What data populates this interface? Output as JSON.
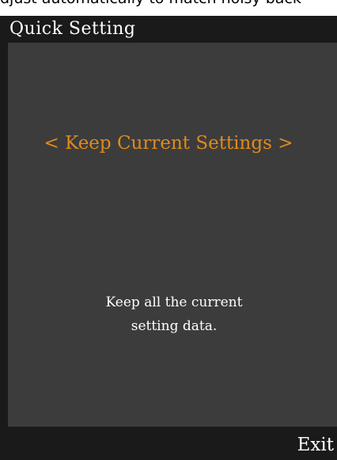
{
  "top_caption": "djust automatically to match noisy back",
  "header": {
    "title": "Quick Setting"
  },
  "option": {
    "prev_arrow": "<",
    "label": "Keep Current Settings",
    "next_arrow": ">"
  },
  "description": {
    "line1": "Keep all the current",
    "line2": "setting data."
  },
  "footer": {
    "exit_label": "Exit"
  },
  "colors": {
    "screen_background": "#3c3c3c",
    "bar_background": "#1a1a1a",
    "selection_accent": "#e08a1e",
    "text": "#ffffff"
  }
}
